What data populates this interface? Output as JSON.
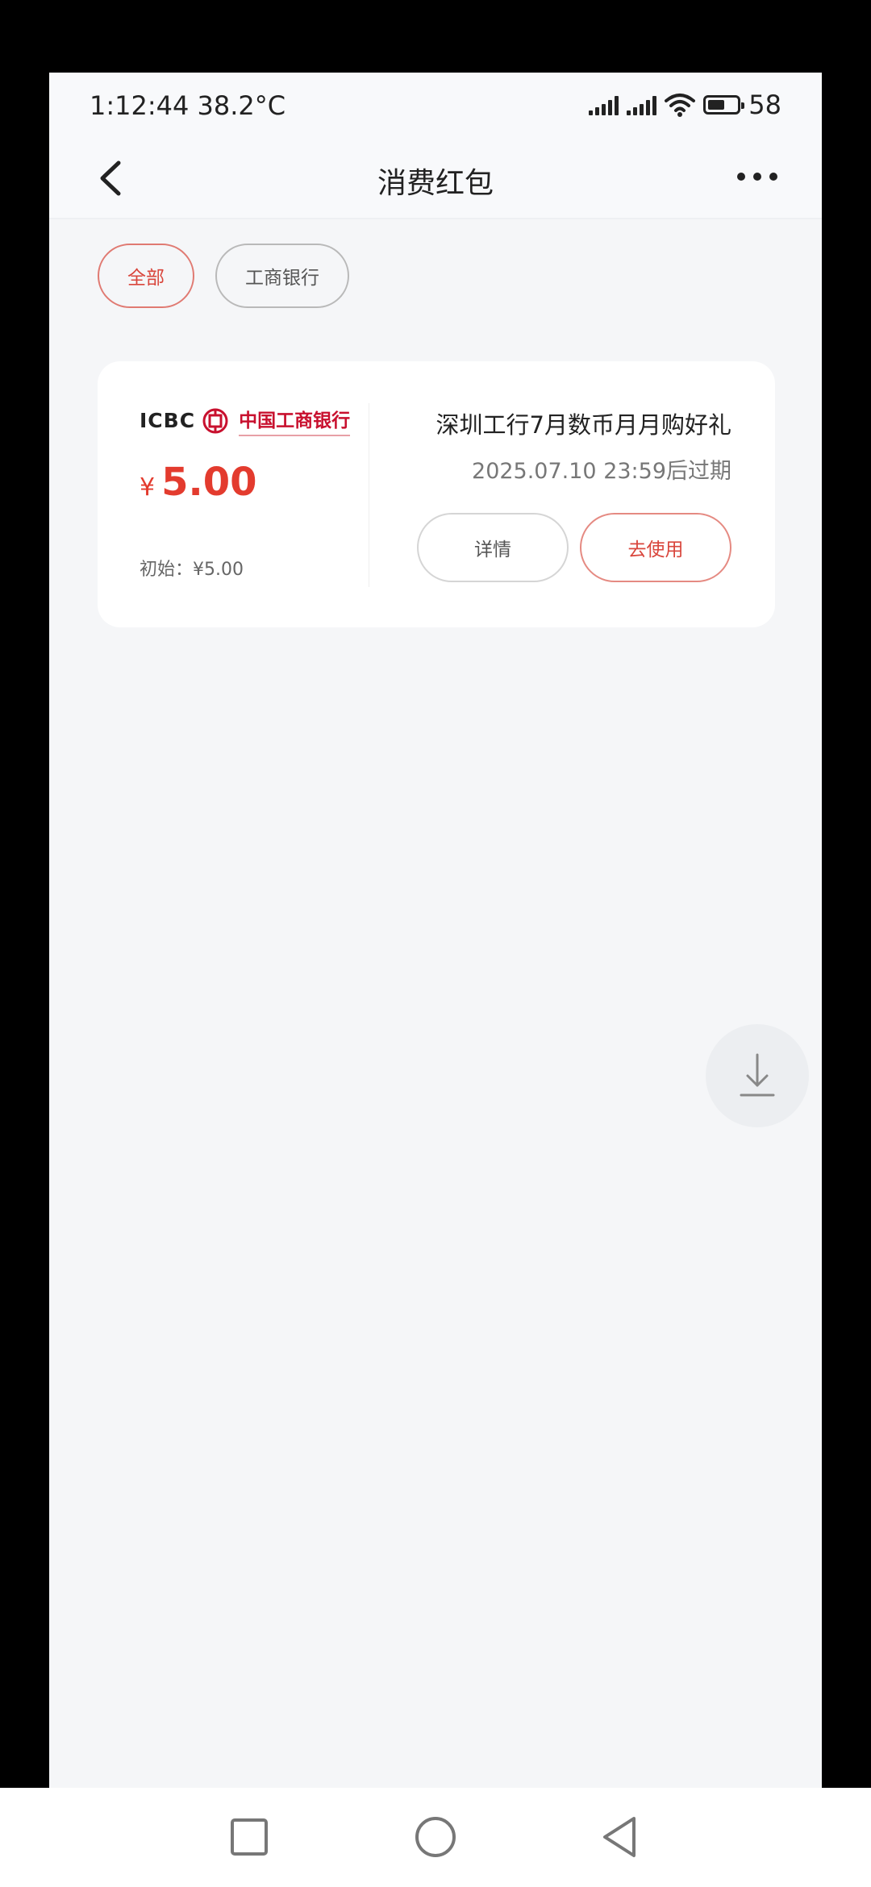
{
  "status_bar": {
    "time": "1:12:44  38.2°C",
    "battery_level": "58"
  },
  "header": {
    "title": "消费红包"
  },
  "filters": [
    {
      "label": "全部",
      "selected": true
    },
    {
      "label": "工商银行",
      "selected": false
    }
  ],
  "coupon": {
    "brand_en": "ICBC",
    "brand_cn": "中国工商银行",
    "currency": "¥",
    "amount": "5.00",
    "initial": "初始：¥5.00",
    "title": "深圳工行7月数币月月购好礼",
    "expiry": "2025.07.10 23:59后过期",
    "detail_label": "详情",
    "use_label": "去使用"
  },
  "colors": {
    "accent": "#d9463c",
    "icbc_red": "#c8102e",
    "background": "#f5f6f8"
  }
}
